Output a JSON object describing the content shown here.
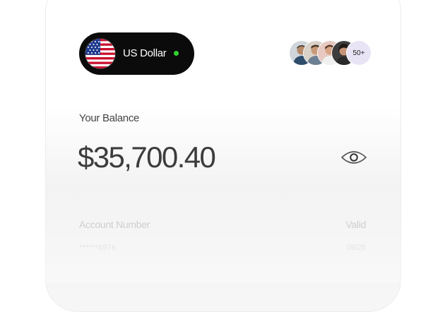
{
  "currency": {
    "label": "US Dollar",
    "flag": "us-flag-icon",
    "status_color": "#2fd12f"
  },
  "members": {
    "avatars": [
      "avatar-1",
      "avatar-2",
      "avatar-3",
      "avatar-4"
    ],
    "more_label": "50+"
  },
  "balance": {
    "label": "Your Balance",
    "amount": "$35,700.40",
    "visibility_icon": "eye-icon"
  },
  "account": {
    "number_label": "Account Number",
    "number_value": "******8976",
    "valid_label": "Valid",
    "valid_value": "09/28"
  },
  "colors": {
    "pill_background": "#0b0b0b",
    "more_badge": "#e8e4f6"
  }
}
